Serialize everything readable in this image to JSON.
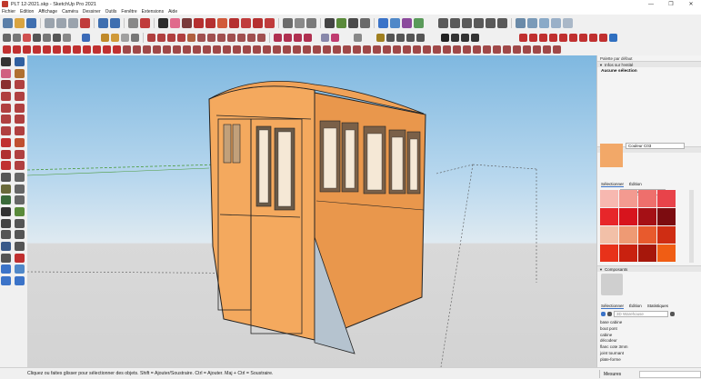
{
  "window": {
    "title": "PLT 12-2021.skp - SketchUp Pro 2021",
    "min": "—",
    "max": "❐",
    "close": "✕"
  },
  "menu": [
    "Fichier",
    "Edition",
    "Affichage",
    "Caméra",
    "Dessiner",
    "Outils",
    "Fenêtre",
    "Extensions",
    "Aide"
  ],
  "right_panel": {
    "header": "Palette par défaut",
    "entity_info": {
      "section": "Infos sur l'entité",
      "value": "Aucune sélection"
    },
    "materials": {
      "section": "Matières",
      "color_name": "Couleur C03",
      "tabs": [
        "Sélectionner",
        "Édition"
      ],
      "library": "Couleurs",
      "swatches": [
        "#f7b8b0",
        "#f39a90",
        "#ee6f6c",
        "#e8434a",
        "#e7262a",
        "#d7141d",
        "#a51015",
        "#7c0c10",
        "#f2c0a8",
        "#ee9a74",
        "#e85a2d",
        "#cf2d13",
        "#e8321a",
        "#c9210f",
        "#a6170b",
        "#f05d14"
      ]
    },
    "components": {
      "section": "Composants",
      "tabs": [
        "Sélectionner",
        "Édition",
        "Statistiques"
      ],
      "search_placeholder": "3D Warehouse",
      "items": [
        "base cabine",
        "bout pont",
        "cabine",
        "décodeur",
        "flanc cote 3mm",
        "joint tournant",
        "plate-forme"
      ]
    }
  },
  "status": {
    "text": "Cliquez ou faites glisser pour sélectionner des objets. Shift = Ajouter/Soustraire. Ctrl = Ajouter. Maj + Ctrl = Soustraire.",
    "measures_label": "Mesures"
  },
  "colors": {
    "accent": "#3b73c8",
    "cabin": "#f4a95e",
    "cabin_side": "#e9974c",
    "sky_top": "#7fb8e0",
    "ground": "#d3d3d3"
  }
}
